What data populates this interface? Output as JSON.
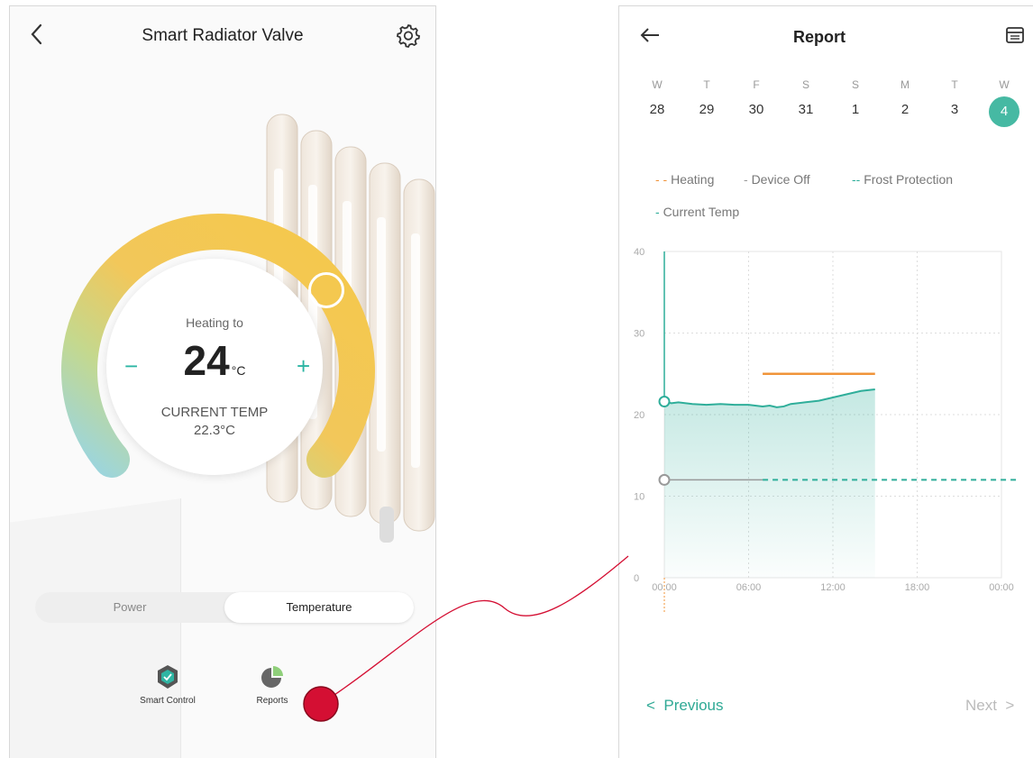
{
  "left": {
    "title": "Smart Radiator Valve",
    "dial": {
      "heating_label": "Heating to",
      "set_temp": "24",
      "set_unit": "°C",
      "minus": "−",
      "plus": "+",
      "current_label": "CURRENT TEMP",
      "current_value": "22.3°C"
    },
    "toggle": {
      "power": "Power",
      "temperature": "Temperature",
      "selected": "Temperature"
    },
    "bottom": {
      "smart_control": "Smart Control",
      "reports": "Reports"
    }
  },
  "right": {
    "title": "Report",
    "days": [
      {
        "letter": "W",
        "num": "28"
      },
      {
        "letter": "T",
        "num": "29"
      },
      {
        "letter": "F",
        "num": "30"
      },
      {
        "letter": "S",
        "num": "31"
      },
      {
        "letter": "S",
        "num": "1"
      },
      {
        "letter": "M",
        "num": "2"
      },
      {
        "letter": "T",
        "num": "3"
      },
      {
        "letter": "W",
        "num": "4",
        "selected": true
      }
    ],
    "legend": {
      "heating": "Heating",
      "device_off": "Device Off",
      "frost": "Frost Protection",
      "current": "Current Temp"
    },
    "nav": {
      "previous": "Previous",
      "next": "Next"
    }
  },
  "colors": {
    "teal": "#2fae9a",
    "orange": "#f0943a",
    "selected_day": "#46b9a3",
    "dial_yellow": "#f4c649",
    "dial_teal": "#8fd3d8",
    "connector": "#d40f33"
  },
  "chart_data": {
    "type": "line",
    "x_ticks": [
      "00:00",
      "06:00",
      "12:00",
      "18:00",
      "00:00"
    ],
    "y_ticks": [
      "0",
      "10",
      "20",
      "30",
      "40"
    ],
    "ylim": [
      0,
      40
    ],
    "xlim_hours": [
      0,
      24
    ],
    "grid": true,
    "series": [
      {
        "name": "Current Temp",
        "style": "solid-filled",
        "points": [
          [
            0,
            21.6
          ],
          [
            0.5,
            21.4
          ],
          [
            1,
            21.5
          ],
          [
            2,
            21.3
          ],
          [
            3,
            21.2
          ],
          [
            4,
            21.3
          ],
          [
            5,
            21.2
          ],
          [
            6,
            21.2
          ],
          [
            7,
            21.0
          ],
          [
            7.5,
            21.1
          ],
          [
            8,
            20.9
          ],
          [
            8.5,
            21.0
          ],
          [
            9,
            21.3
          ],
          [
            10,
            21.5
          ],
          [
            11,
            21.7
          ],
          [
            12,
            22.1
          ],
          [
            13,
            22.5
          ],
          [
            14,
            22.9
          ],
          [
            15,
            23.1
          ]
        ]
      },
      {
        "name": "Heating",
        "style": "solid",
        "points": [
          [
            7,
            25
          ],
          [
            15,
            25
          ]
        ]
      },
      {
        "name": "Frost Protection",
        "style": "dashed",
        "points": [
          [
            0,
            12
          ],
          [
            24,
            12
          ]
        ]
      }
    ]
  }
}
